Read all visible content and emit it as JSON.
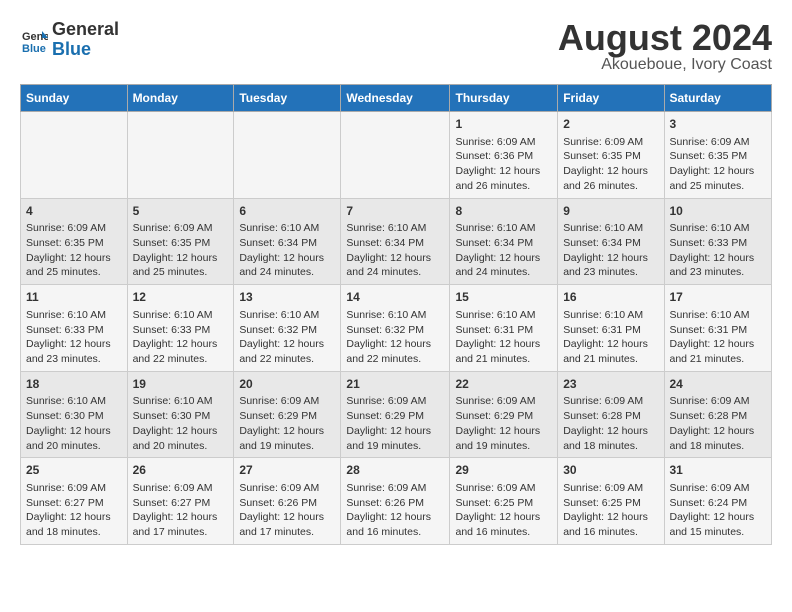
{
  "header": {
    "logo_line1": "General",
    "logo_line2": "Blue",
    "title": "August 2024",
    "subtitle": "Akoueboue, Ivory Coast"
  },
  "days_of_week": [
    "Sunday",
    "Monday",
    "Tuesday",
    "Wednesday",
    "Thursday",
    "Friday",
    "Saturday"
  ],
  "weeks": [
    [
      {
        "day": "",
        "info": ""
      },
      {
        "day": "",
        "info": ""
      },
      {
        "day": "",
        "info": ""
      },
      {
        "day": "",
        "info": ""
      },
      {
        "day": "1",
        "info": "Sunrise: 6:09 AM\nSunset: 6:36 PM\nDaylight: 12 hours\nand 26 minutes."
      },
      {
        "day": "2",
        "info": "Sunrise: 6:09 AM\nSunset: 6:35 PM\nDaylight: 12 hours\nand 26 minutes."
      },
      {
        "day": "3",
        "info": "Sunrise: 6:09 AM\nSunset: 6:35 PM\nDaylight: 12 hours\nand 25 minutes."
      }
    ],
    [
      {
        "day": "4",
        "info": "Sunrise: 6:09 AM\nSunset: 6:35 PM\nDaylight: 12 hours\nand 25 minutes."
      },
      {
        "day": "5",
        "info": "Sunrise: 6:09 AM\nSunset: 6:35 PM\nDaylight: 12 hours\nand 25 minutes."
      },
      {
        "day": "6",
        "info": "Sunrise: 6:10 AM\nSunset: 6:34 PM\nDaylight: 12 hours\nand 24 minutes."
      },
      {
        "day": "7",
        "info": "Sunrise: 6:10 AM\nSunset: 6:34 PM\nDaylight: 12 hours\nand 24 minutes."
      },
      {
        "day": "8",
        "info": "Sunrise: 6:10 AM\nSunset: 6:34 PM\nDaylight: 12 hours\nand 24 minutes."
      },
      {
        "day": "9",
        "info": "Sunrise: 6:10 AM\nSunset: 6:34 PM\nDaylight: 12 hours\nand 23 minutes."
      },
      {
        "day": "10",
        "info": "Sunrise: 6:10 AM\nSunset: 6:33 PM\nDaylight: 12 hours\nand 23 minutes."
      }
    ],
    [
      {
        "day": "11",
        "info": "Sunrise: 6:10 AM\nSunset: 6:33 PM\nDaylight: 12 hours\nand 23 minutes."
      },
      {
        "day": "12",
        "info": "Sunrise: 6:10 AM\nSunset: 6:33 PM\nDaylight: 12 hours\nand 22 minutes."
      },
      {
        "day": "13",
        "info": "Sunrise: 6:10 AM\nSunset: 6:32 PM\nDaylight: 12 hours\nand 22 minutes."
      },
      {
        "day": "14",
        "info": "Sunrise: 6:10 AM\nSunset: 6:32 PM\nDaylight: 12 hours\nand 22 minutes."
      },
      {
        "day": "15",
        "info": "Sunrise: 6:10 AM\nSunset: 6:31 PM\nDaylight: 12 hours\nand 21 minutes."
      },
      {
        "day": "16",
        "info": "Sunrise: 6:10 AM\nSunset: 6:31 PM\nDaylight: 12 hours\nand 21 minutes."
      },
      {
        "day": "17",
        "info": "Sunrise: 6:10 AM\nSunset: 6:31 PM\nDaylight: 12 hours\nand 21 minutes."
      }
    ],
    [
      {
        "day": "18",
        "info": "Sunrise: 6:10 AM\nSunset: 6:30 PM\nDaylight: 12 hours\nand 20 minutes."
      },
      {
        "day": "19",
        "info": "Sunrise: 6:10 AM\nSunset: 6:30 PM\nDaylight: 12 hours\nand 20 minutes."
      },
      {
        "day": "20",
        "info": "Sunrise: 6:09 AM\nSunset: 6:29 PM\nDaylight: 12 hours\nand 19 minutes."
      },
      {
        "day": "21",
        "info": "Sunrise: 6:09 AM\nSunset: 6:29 PM\nDaylight: 12 hours\nand 19 minutes."
      },
      {
        "day": "22",
        "info": "Sunrise: 6:09 AM\nSunset: 6:29 PM\nDaylight: 12 hours\nand 19 minutes."
      },
      {
        "day": "23",
        "info": "Sunrise: 6:09 AM\nSunset: 6:28 PM\nDaylight: 12 hours\nand 18 minutes."
      },
      {
        "day": "24",
        "info": "Sunrise: 6:09 AM\nSunset: 6:28 PM\nDaylight: 12 hours\nand 18 minutes."
      }
    ],
    [
      {
        "day": "25",
        "info": "Sunrise: 6:09 AM\nSunset: 6:27 PM\nDaylight: 12 hours\nand 18 minutes."
      },
      {
        "day": "26",
        "info": "Sunrise: 6:09 AM\nSunset: 6:27 PM\nDaylight: 12 hours\nand 17 minutes."
      },
      {
        "day": "27",
        "info": "Sunrise: 6:09 AM\nSunset: 6:26 PM\nDaylight: 12 hours\nand 17 minutes."
      },
      {
        "day": "28",
        "info": "Sunrise: 6:09 AM\nSunset: 6:26 PM\nDaylight: 12 hours\nand 16 minutes."
      },
      {
        "day": "29",
        "info": "Sunrise: 6:09 AM\nSunset: 6:25 PM\nDaylight: 12 hours\nand 16 minutes."
      },
      {
        "day": "30",
        "info": "Sunrise: 6:09 AM\nSunset: 6:25 PM\nDaylight: 12 hours\nand 16 minutes."
      },
      {
        "day": "31",
        "info": "Sunrise: 6:09 AM\nSunset: 6:24 PM\nDaylight: 12 hours\nand 15 minutes."
      }
    ]
  ]
}
